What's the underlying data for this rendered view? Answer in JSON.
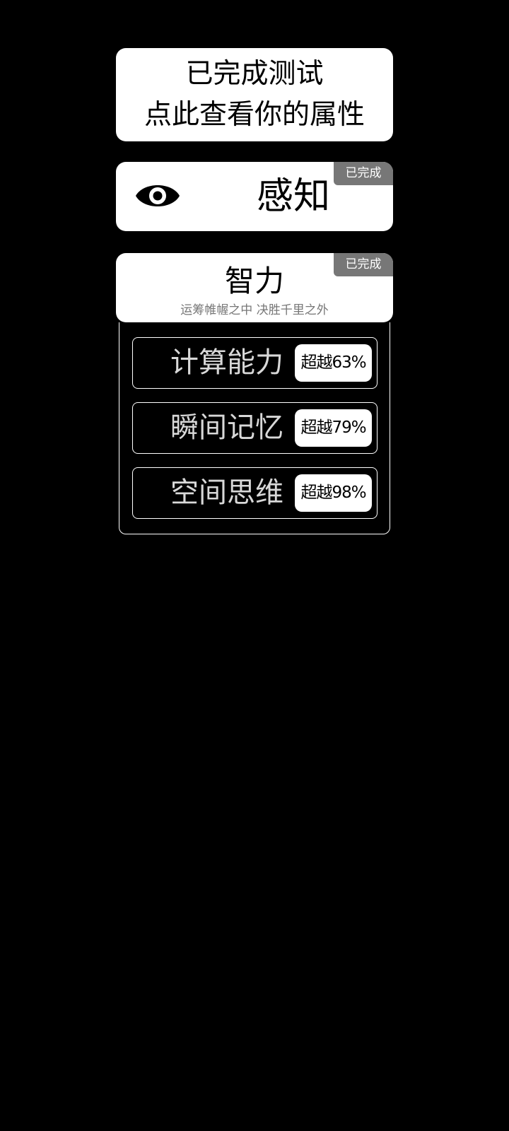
{
  "result_card": {
    "line1": "已完成测试",
    "line2": "点此查看你的属性"
  },
  "perception": {
    "title": "感知",
    "badge": "已完成",
    "icon": "eye-icon"
  },
  "intelligence": {
    "title": "智力",
    "subtitle": "运筹帷幄之中 决胜千里之外",
    "badge": "已完成",
    "items": [
      {
        "label": "计算能力",
        "score": "超越63%"
      },
      {
        "label": "瞬间记忆",
        "score": "超越79%"
      },
      {
        "label": "空间思维",
        "score": "超越98%"
      }
    ]
  },
  "colors": {
    "background": "#000000",
    "card": "#ffffff",
    "badge": "#777777",
    "subtitle": "#777777"
  }
}
